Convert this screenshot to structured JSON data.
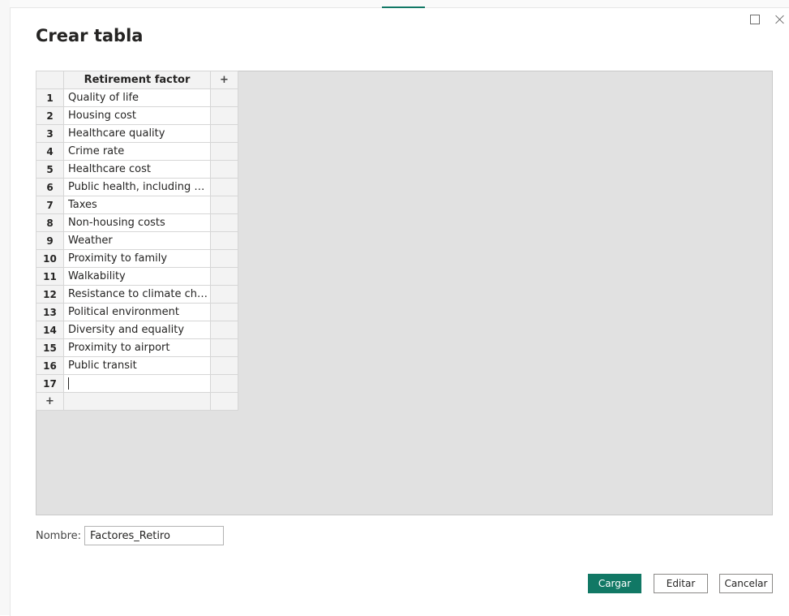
{
  "dialog": {
    "title": "Crear tabla"
  },
  "window_controls": {
    "maximize_icon": "maximize-icon",
    "close_icon": "close-icon"
  },
  "grid": {
    "column_header": "Retirement factor",
    "add_column_label": "+",
    "add_row_label": "+",
    "rows": [
      {
        "index": "1",
        "value": "Quality of life"
      },
      {
        "index": "2",
        "value": "Housing cost"
      },
      {
        "index": "3",
        "value": "Healthcare quality"
      },
      {
        "index": "4",
        "value": "Crime rate"
      },
      {
        "index": "5",
        "value": "Healthcare cost"
      },
      {
        "index": "6",
        "value": "Public health, including Co..."
      },
      {
        "index": "7",
        "value": "Taxes"
      },
      {
        "index": "8",
        "value": "Non-housing costs"
      },
      {
        "index": "9",
        "value": "Weather"
      },
      {
        "index": "10",
        "value": "Proximity to family"
      },
      {
        "index": "11",
        "value": "Walkability"
      },
      {
        "index": "12",
        "value": "Resistance to climate change"
      },
      {
        "index": "13",
        "value": "Political environment"
      },
      {
        "index": "14",
        "value": "Diversity and equality"
      },
      {
        "index": "15",
        "value": "Proximity to airport"
      },
      {
        "index": "16",
        "value": "Public transit"
      },
      {
        "index": "17",
        "value": ""
      }
    ]
  },
  "name_field": {
    "label": "Nombre:",
    "value": "Factores_Retiro"
  },
  "buttons": {
    "load": "Cargar",
    "edit": "Editar",
    "cancel": "Cancelar"
  },
  "colors": {
    "accent": "#117865",
    "grid_background": "#e1e1e1"
  }
}
